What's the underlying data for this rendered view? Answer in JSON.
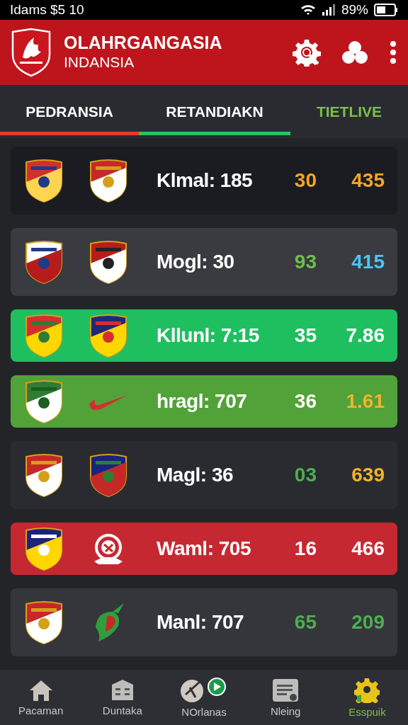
{
  "status_bar": {
    "left_text": "Idams $5 10",
    "battery_text": "89%"
  },
  "header": {
    "title": "OLAHRGANGASIA",
    "subtitle": "INDANSIA"
  },
  "tabs": [
    {
      "label": "PEDRANSIA",
      "kind": "underlined",
      "color": "#e53935"
    },
    {
      "label": "RETANDIAKN",
      "kind": "underlined",
      "color": "#22c55e"
    },
    {
      "label": "TIETLIVE",
      "kind": "colored",
      "color": "#7ac143"
    }
  ],
  "matches": [
    {
      "kind": "plain",
      "color": "#1b1c21",
      "label": "Klmal: 185",
      "scores": [
        {
          "text": "30",
          "color": "#f5a623"
        },
        {
          "text": "435",
          "color": "#f5a623"
        }
      ]
    },
    {
      "kind": "plain",
      "color": "#3a3b40",
      "label": "Mogl: 30",
      "scores": [
        {
          "text": "93",
          "color": "#6cc04a"
        },
        {
          "text": "415",
          "color": "#4fc3f7"
        }
      ]
    },
    {
      "kind": "highlight",
      "color": "#1fbf5f",
      "label": "Kllunl: 7:15",
      "scores": [
        {
          "text": "35",
          "color": "#ffffff"
        },
        {
          "text": "7.86",
          "color": "#ffffff"
        }
      ]
    },
    {
      "kind": "highlight",
      "color": "#52a23a",
      "label": "hragl: 707",
      "scores": [
        {
          "text": "36",
          "color": "#ffffff"
        },
        {
          "text": "1.61",
          "color": "#f0b429"
        }
      ]
    },
    {
      "kind": "plain",
      "color": "#2a2b30",
      "label": "Magl: 36",
      "scores": [
        {
          "text": "03",
          "color": "#4caf50"
        },
        {
          "text": "639",
          "color": "#f0b429"
        }
      ]
    },
    {
      "kind": "highlight",
      "color": "#c62832",
      "label": "Waml: 705",
      "scores": [
        {
          "text": "16",
          "color": "#ffffff"
        },
        {
          "text": "466",
          "color": "#ffffff"
        }
      ]
    },
    {
      "kind": "plain",
      "color": "#35363b",
      "label": "Manl: 707",
      "scores": [
        {
          "text": "65",
          "color": "#4caf50"
        },
        {
          "text": "209",
          "color": "#4caf50"
        }
      ]
    }
  ],
  "bottom_nav": [
    {
      "label": "Pacaman",
      "selected": false
    },
    {
      "label": "Duntaka",
      "selected": false
    },
    {
      "label": "NOrlanas",
      "selected": false
    },
    {
      "label": "Nleing",
      "selected": false
    },
    {
      "label": "Esspuik",
      "selected": true
    }
  ]
}
